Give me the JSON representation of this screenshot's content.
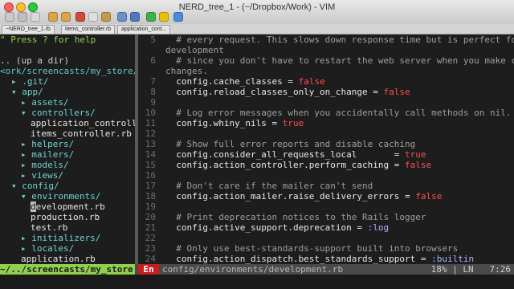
{
  "window": {
    "title": "NERD_tree_1 - (~/Dropbox/Work) - VIM"
  },
  "tabs": [
    "~NERD_tree_1.rb",
    "items_controller.rb",
    "application_cont..."
  ],
  "tree": {
    "help": "\" Press ? for help",
    "up": ".. (up a dir)",
    "root": "<ork/screencasts/my_store/",
    "items": [
      {
        "indent": 1,
        "text": "▸ .git/",
        "kind": "dir"
      },
      {
        "indent": 1,
        "text": "▾ app/",
        "kind": "dir"
      },
      {
        "indent": 2,
        "text": "▸ assets/",
        "kind": "dir"
      },
      {
        "indent": 2,
        "text": "▾ controllers/",
        "kind": "dir"
      },
      {
        "indent": 3,
        "text": "application_controll",
        "kind": "file"
      },
      {
        "indent": 3,
        "text": "items_controller.rb",
        "kind": "file"
      },
      {
        "indent": 2,
        "text": "▸ helpers/",
        "kind": "dir"
      },
      {
        "indent": 2,
        "text": "▸ mailers/",
        "kind": "dir"
      },
      {
        "indent": 2,
        "text": "▸ models/",
        "kind": "dir"
      },
      {
        "indent": 2,
        "text": "▸ views/",
        "kind": "dir"
      },
      {
        "indent": 1,
        "text": "▾ config/",
        "kind": "dir"
      },
      {
        "indent": 2,
        "text": "▾ environments/",
        "kind": "dir"
      },
      {
        "indent": 3,
        "text": "development.rb",
        "kind": "file"
      },
      {
        "indent": 3,
        "text": "production.rb",
        "kind": "file"
      },
      {
        "indent": 3,
        "text": "test.rb",
        "kind": "file"
      },
      {
        "indent": 2,
        "text": "▸ initializers/",
        "kind": "dir"
      },
      {
        "indent": 2,
        "text": "▸ locales/",
        "kind": "dir"
      },
      {
        "indent": 2,
        "text": "application.rb",
        "kind": "file"
      }
    ]
  },
  "editor": {
    "lines": [
      {
        "n": "5",
        "text": "  # every request. This slows down response time but is perfect for",
        "type": "cm"
      },
      {
        "n": "",
        "text": "development",
        "type": "cm"
      },
      {
        "n": "6",
        "text": "  # since you don't have to restart the web server when you make code",
        "type": "cm"
      },
      {
        "n": "",
        "text": "changes.",
        "type": "cm"
      },
      {
        "n": "7",
        "pre": "  config.cache_classes = ",
        "kw": "false"
      },
      {
        "n": "8",
        "pre": "  config.reload_classes_only_on_change = ",
        "kw": "false"
      },
      {
        "n": "9",
        "text": "",
        "type": "plain"
      },
      {
        "n": "10",
        "text": "  # Log error messages when you accidentally call methods on nil.",
        "type": "cm"
      },
      {
        "n": "11",
        "pre": "  config.whiny_nils = ",
        "kw": "true"
      },
      {
        "n": "12",
        "text": "",
        "type": "plain"
      },
      {
        "n": "13",
        "text": "  # Show full error reports and disable caching",
        "type": "cm"
      },
      {
        "n": "14",
        "pre": "  config.consider_all_requests_local       = ",
        "kw": "true"
      },
      {
        "n": "15",
        "pre": "  config.action_controller.perform_caching = ",
        "kw": "false"
      },
      {
        "n": "16",
        "text": "",
        "type": "plain"
      },
      {
        "n": "17",
        "text": "  # Don't care if the mailer can't send",
        "type": "cm"
      },
      {
        "n": "18",
        "pre": "  config.action_mailer.raise_delivery_errors = ",
        "kw": "false"
      },
      {
        "n": "19",
        "text": "",
        "type": "plain"
      },
      {
        "n": "20",
        "text": "  # Print deprecation notices to the Rails logger",
        "type": "cm"
      },
      {
        "n": "21",
        "pre": "  config.active_support.deprecation = ",
        "sym": ":log"
      },
      {
        "n": "22",
        "text": "",
        "type": "plain"
      },
      {
        "n": "23",
        "text": "  # Only use best-standards-support built into browsers",
        "type": "cm"
      },
      {
        "n": "24",
        "pre": "  config.action_dispatch.best_standards_support = ",
        "sym": ":builtin"
      }
    ]
  },
  "status": {
    "left": "~/../screencasts/my_store",
    "mode": "En",
    "file": "config/environments/development.rb",
    "right": "18% | LN   7:26"
  },
  "colors": {
    "status_green": "#8fd14f",
    "mode_red": "#c81e1e",
    "keyword": "#ff4d4d"
  }
}
